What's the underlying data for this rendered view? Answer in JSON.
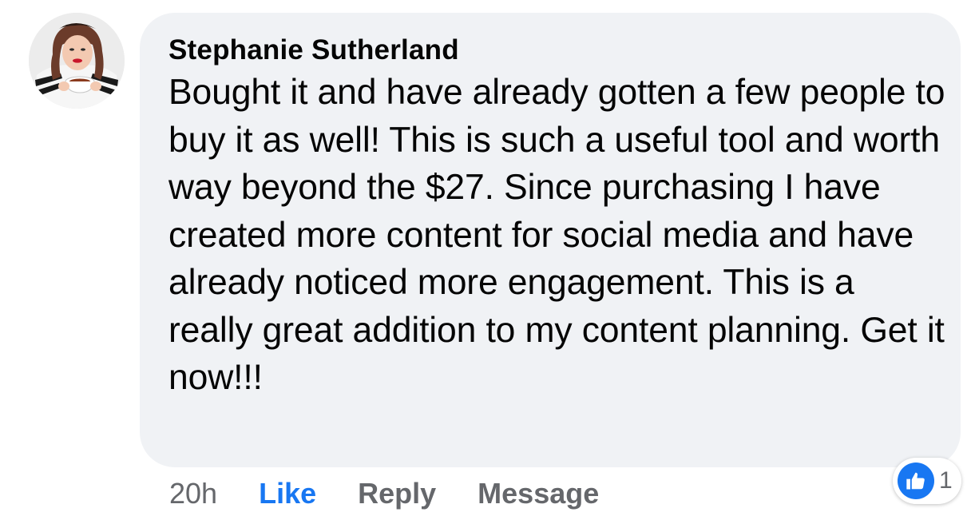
{
  "comment": {
    "author": "Stephanie Sutherland",
    "text": "Bought it and have already gotten a few people to buy it as well! This is such a useful tool and worth way beyond the $27. Since purchasing I have created more content for social media and have already noticed more engagement. This is a really great addition to my content planning. Get it now!!!",
    "timestamp": "20h",
    "actions": {
      "like": "Like",
      "reply": "Reply",
      "message": "Message"
    },
    "reactions": {
      "icon": "thumbs-up-icon",
      "count": "1"
    }
  },
  "colors": {
    "bubble": "#f0f2f5",
    "like_active": "#1877f2",
    "secondary_text": "#65676b",
    "primary_text": "#050505"
  }
}
